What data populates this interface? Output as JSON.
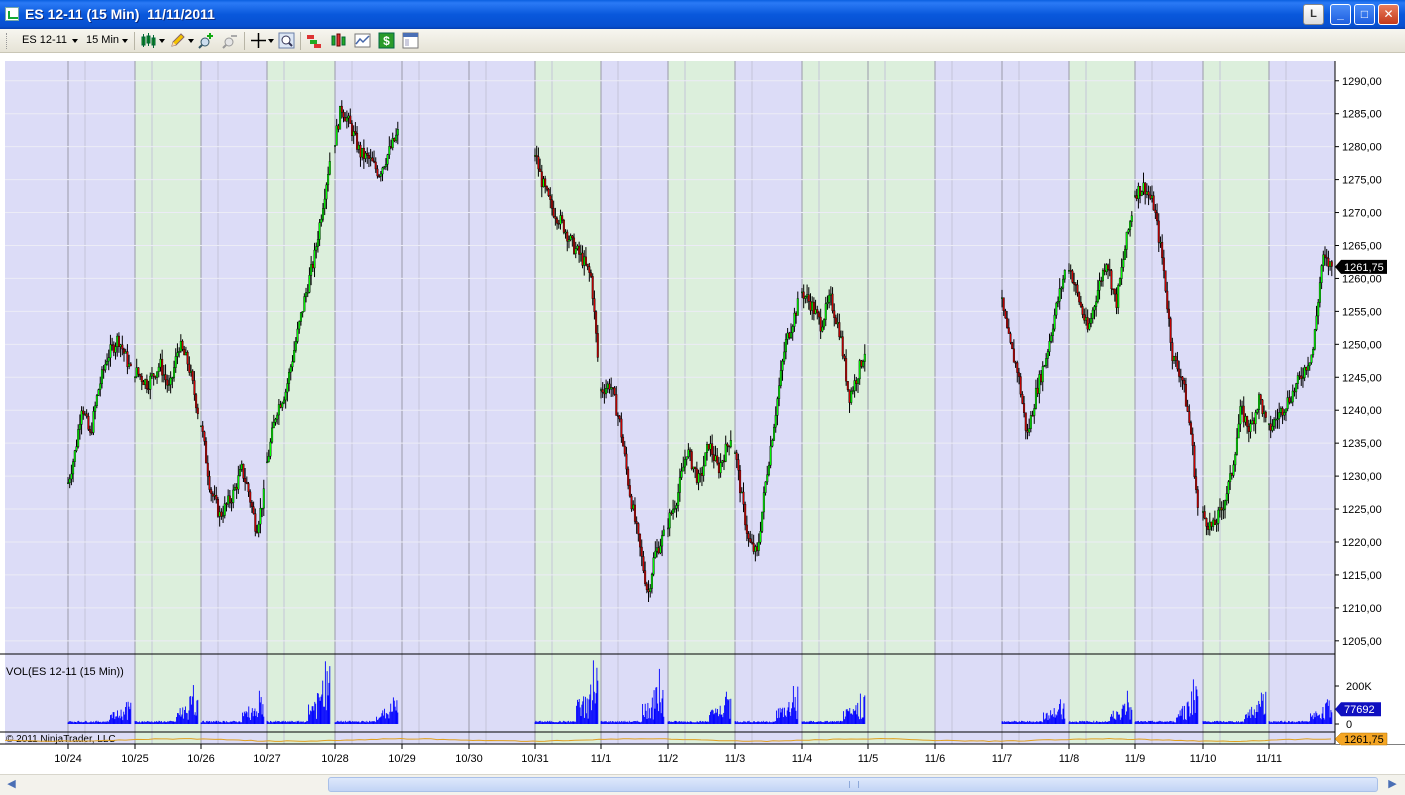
{
  "window": {
    "title": "ES 12-11 (15 Min)  11/11/2011",
    "buttons": {
      "lock": "L",
      "minimize": "_",
      "maximize": "□",
      "close": "✕"
    }
  },
  "toolbar": {
    "instrument": "ES 12-11",
    "interval": "15 Min",
    "icons": [
      "candlestick-style-icon",
      "drawing-pencil-icon",
      "zoom-in-icon",
      "zoom-out-icon",
      "crosshair-icon",
      "magnifier-icon",
      "strategies-icon",
      "indicators-icon",
      "chart-properties-icon",
      "dollar-order-icon",
      "data-box-icon"
    ]
  },
  "chart_data": {
    "type": "candlestick",
    "instrument": "ES 12-11",
    "interval": "15 Min",
    "x_tick_labels": [
      "10/24",
      "10/25",
      "10/26",
      "10/27",
      "10/28",
      "10/29",
      "10/30",
      "10/31",
      "11/1",
      "11/2",
      "11/3",
      "11/4",
      "11/5",
      "11/6",
      "11/7",
      "11/8",
      "11/9",
      "11/10",
      "11/11"
    ],
    "price_axis": {
      "ticks": [
        "1290,00",
        "1285,00",
        "1280,00",
        "1275,00",
        "1270,00",
        "1265,00",
        "1260,00",
        "1255,00",
        "1250,00",
        "1245,00",
        "1240,00",
        "1235,00",
        "1230,00",
        "1225,00",
        "1220,00",
        "1215,00",
        "1210,00",
        "1205,00"
      ],
      "ylim": [
        1203,
        1293
      ],
      "last_price": "1261,75"
    },
    "price_path": [
      {
        "x": "10/24",
        "points": [
          [
            0.0,
            1229
          ],
          [
            0.12,
            1234
          ],
          [
            0.22,
            1241
          ],
          [
            0.35,
            1236
          ],
          [
            0.48,
            1243
          ],
          [
            0.62,
            1248
          ],
          [
            0.8,
            1251
          ],
          [
            1.0,
            1246
          ]
        ]
      },
      {
        "x": "10/25",
        "points": [
          [
            0.0,
            1246
          ],
          [
            0.2,
            1244
          ],
          [
            0.4,
            1247
          ],
          [
            0.55,
            1243
          ],
          [
            0.7,
            1250
          ],
          [
            0.85,
            1247
          ],
          [
            1.0,
            1240
          ]
        ]
      },
      {
        "x": "10/26",
        "points": [
          [
            0.0,
            1238
          ],
          [
            0.15,
            1228
          ],
          [
            0.3,
            1224
          ],
          [
            0.5,
            1227
          ],
          [
            0.65,
            1231
          ],
          [
            0.75,
            1228
          ],
          [
            0.88,
            1222
          ],
          [
            1.0,
            1227
          ]
        ]
      },
      {
        "x": "10/27",
        "points": [
          [
            0.0,
            1232
          ],
          [
            0.15,
            1240
          ],
          [
            0.3,
            1243
          ],
          [
            0.45,
            1250
          ],
          [
            0.6,
            1257
          ],
          [
            0.75,
            1263
          ],
          [
            0.9,
            1272
          ],
          [
            1.0,
            1278
          ]
        ]
      },
      {
        "x": "10/28",
        "points": [
          [
            0.0,
            1281
          ],
          [
            0.1,
            1286
          ],
          [
            0.25,
            1283
          ],
          [
            0.4,
            1279
          ],
          [
            0.55,
            1278
          ],
          [
            0.7,
            1276
          ],
          [
            0.85,
            1279
          ],
          [
            1.0,
            1282
          ]
        ]
      },
      {
        "x": "10/31",
        "points": [
          [
            0.0,
            1279
          ],
          [
            0.1,
            1275
          ],
          [
            0.25,
            1271
          ],
          [
            0.45,
            1268
          ],
          [
            0.6,
            1265
          ],
          [
            0.75,
            1263
          ],
          [
            0.9,
            1260
          ],
          [
            1.0,
            1248
          ]
        ]
      },
      {
        "x": "11/1",
        "points": [
          [
            0.0,
            1243
          ],
          [
            0.15,
            1244
          ],
          [
            0.3,
            1238
          ],
          [
            0.45,
            1228
          ],
          [
            0.6,
            1220
          ],
          [
            0.75,
            1212
          ],
          [
            0.85,
            1218
          ],
          [
            1.0,
            1221
          ]
        ]
      },
      {
        "x": "11/2",
        "points": [
          [
            0.0,
            1223
          ],
          [
            0.15,
            1227
          ],
          [
            0.3,
            1234
          ],
          [
            0.5,
            1229
          ],
          [
            0.65,
            1235
          ],
          [
            0.8,
            1231
          ],
          [
            1.0,
            1236
          ]
        ]
      },
      {
        "x": "11/3",
        "points": [
          [
            0.0,
            1234
          ],
          [
            0.1,
            1227
          ],
          [
            0.22,
            1220
          ],
          [
            0.35,
            1218
          ],
          [
            0.5,
            1230
          ],
          [
            0.65,
            1240
          ],
          [
            0.8,
            1250
          ],
          [
            1.0,
            1256
          ]
        ]
      },
      {
        "x": "11/4",
        "points": [
          [
            0.0,
            1258
          ],
          [
            0.15,
            1256
          ],
          [
            0.3,
            1253
          ],
          [
            0.45,
            1257
          ],
          [
            0.6,
            1252
          ],
          [
            0.75,
            1242
          ],
          [
            0.87,
            1245
          ],
          [
            1.0,
            1249
          ]
        ]
      },
      {
        "x": "11/7",
        "points": [
          [
            0.0,
            1256
          ],
          [
            0.12,
            1250
          ],
          [
            0.25,
            1246
          ],
          [
            0.4,
            1236
          ],
          [
            0.55,
            1243
          ],
          [
            0.7,
            1248
          ],
          [
            0.85,
            1255
          ],
          [
            1.0,
            1261
          ]
        ]
      },
      {
        "x": "11/8",
        "points": [
          [
            0.0,
            1262
          ],
          [
            0.15,
            1257
          ],
          [
            0.3,
            1252
          ],
          [
            0.45,
            1258
          ],
          [
            0.6,
            1263
          ],
          [
            0.75,
            1256
          ],
          [
            0.9,
            1265
          ],
          [
            1.0,
            1270
          ]
        ]
      },
      {
        "x": "11/9",
        "points": [
          [
            0.0,
            1273
          ],
          [
            0.15,
            1274
          ],
          [
            0.3,
            1271
          ],
          [
            0.45,
            1262
          ],
          [
            0.6,
            1248
          ],
          [
            0.75,
            1245
          ],
          [
            0.9,
            1236
          ],
          [
            1.0,
            1225
          ]
        ]
      },
      {
        "x": "11/10",
        "points": [
          [
            0.0,
            1224
          ],
          [
            0.15,
            1222
          ],
          [
            0.3,
            1225
          ],
          [
            0.45,
            1230
          ],
          [
            0.6,
            1240
          ],
          [
            0.75,
            1237
          ],
          [
            0.9,
            1242
          ],
          [
            1.0,
            1238
          ]
        ]
      },
      {
        "x": "11/11",
        "points": [
          [
            0.0,
            1237
          ],
          [
            0.2,
            1240
          ],
          [
            0.4,
            1243
          ],
          [
            0.55,
            1246
          ],
          [
            0.7,
            1249
          ],
          [
            0.85,
            1263
          ],
          [
            1.0,
            1261.75
          ]
        ]
      }
    ],
    "session_shading": [
      {
        "start": "10/24",
        "end": "10/25",
        "color": "#dcdcf7"
      },
      {
        "start": "10/25",
        "end": "10/26",
        "color": "#dcefdc"
      },
      {
        "start": "10/26",
        "end": "10/27",
        "color": "#dcdcf7"
      },
      {
        "start": "10/27",
        "end": "10/28",
        "color": "#dcefdc"
      },
      {
        "start": "10/28",
        "end": "10/31",
        "color": "#dcdcf7"
      },
      {
        "start": "10/31",
        "end": "11/1",
        "color": "#dcefdc"
      },
      {
        "start": "11/1",
        "end": "11/2",
        "color": "#dcdcf7"
      },
      {
        "start": "11/2",
        "end": "11/3",
        "color": "#dcefdc"
      },
      {
        "start": "11/3",
        "end": "11/4",
        "color": "#dcdcf7"
      },
      {
        "start": "11/4",
        "end": "11/6",
        "color": "#dcefdc"
      },
      {
        "start": "11/6",
        "end": "11/8",
        "color": "#dcdcf7"
      },
      {
        "start": "11/8",
        "end": "11/9",
        "color": "#dcefdc"
      },
      {
        "start": "11/9",
        "end": "11/10",
        "color": "#dcdcf7"
      },
      {
        "start": "11/10",
        "end": "11/11",
        "color": "#dcefdc"
      },
      {
        "start": "11/11",
        "end": "end",
        "color": "#dcdcf7"
      }
    ],
    "volume": {
      "label": "VOL(ES 12-11 (15 Min))",
      "ticks": [
        "200K",
        "0"
      ],
      "ylim": [
        0,
        300000
      ],
      "last_value": "77692",
      "spikes": [
        {
          "x": "10/24",
          "value": 115000
        },
        {
          "x": "10/25",
          "value": 205000
        },
        {
          "x": "10/26",
          "value": 175000
        },
        {
          "x": "10/27",
          "value": 330000
        },
        {
          "x": "10/28",
          "value": 140000
        },
        {
          "x": "10/31",
          "value": 335000
        },
        {
          "x": "11/1",
          "value": 290000
        },
        {
          "x": "11/2",
          "value": 170000
        },
        {
          "x": "11/3",
          "value": 200000
        },
        {
          "x": "11/4",
          "value": 160000
        },
        {
          "x": "11/7",
          "value": 130000
        },
        {
          "x": "11/8",
          "value": 175000
        },
        {
          "x": "11/9",
          "value": 235000
        },
        {
          "x": "11/10",
          "value": 165000
        },
        {
          "x": "11/11",
          "value": 130000
        }
      ]
    },
    "indicator": {
      "copyright": "© 2011 NinjaTrader, LLC",
      "last_value": "1261,75",
      "line_color": "#e0a020"
    },
    "colors": {
      "up_candle": "#00ff00",
      "down_candle": "#cc0000",
      "wick": "#000000",
      "volume_bar": "#0000ff",
      "last_price_badge": "#000000",
      "volume_badge": "#1010c0",
      "indicator_badge": "#f5a623"
    }
  }
}
